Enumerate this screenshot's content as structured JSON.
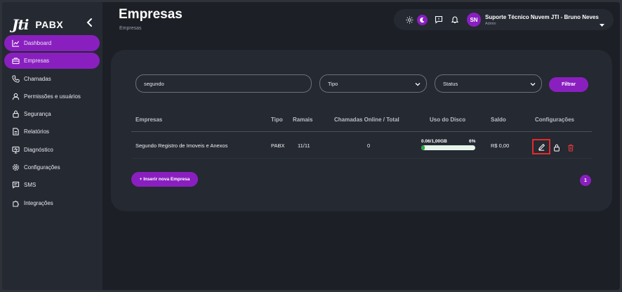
{
  "app": {
    "logo_mark": "Jti",
    "logo_text": "PABX"
  },
  "sidebar": {
    "items": [
      {
        "label": "Dashboard",
        "icon": "chart-line-icon",
        "active": true
      },
      {
        "label": "Empresas",
        "icon": "briefcase-icon",
        "active": true
      },
      {
        "label": "Chamadas",
        "icon": "phone-icon",
        "active": false
      },
      {
        "label": "Permissões e usuários",
        "icon": "user-icon",
        "active": false
      },
      {
        "label": "Segurança",
        "icon": "lock-icon",
        "active": false
      },
      {
        "label": "Relatórios",
        "icon": "document-icon",
        "active": false
      },
      {
        "label": "Diagnóstico",
        "icon": "monitor-icon",
        "active": false
      },
      {
        "label": "Configurações",
        "icon": "gear-icon",
        "active": false
      },
      {
        "label": "SMS",
        "icon": "message-icon",
        "active": false
      },
      {
        "label": "Integrações",
        "icon": "puzzle-icon",
        "active": false
      }
    ]
  },
  "header": {
    "title": "Empresas",
    "breadcrumb": "Empresas",
    "user": {
      "initials": "SN",
      "name": "Suporte Técnico Nuvem JTI - Bruno Neves",
      "role": "Admin"
    }
  },
  "filters": {
    "search_value": "segundo",
    "tipo_selected": "Tipo",
    "status_selected": "Status",
    "filter_label": "Filtrar"
  },
  "table": {
    "headers": [
      "Empresas",
      "Tipo",
      "Ramais",
      "Chamadas Online / Total",
      "Uso do Disco",
      "Saldo",
      "Configurações"
    ],
    "rows": [
      {
        "empresa": "Segundo Registro de Imoveis e Anexos",
        "tipo": "PABX",
        "ramais": "11/11",
        "chamadas": "0",
        "disco_label": "0.06/1,00GB",
        "disco_pct": "6%",
        "disco_fraction": 0.06,
        "saldo": "R$ 0,00"
      }
    ]
  },
  "actions": {
    "insert_label": "+ Inserir nova Empresa"
  },
  "pagination": {
    "current": "1"
  },
  "colors": {
    "accent": "#8a1fc0",
    "highlight": "#e22b2b",
    "delete": "#e03a3a",
    "disk": "#28a745"
  }
}
